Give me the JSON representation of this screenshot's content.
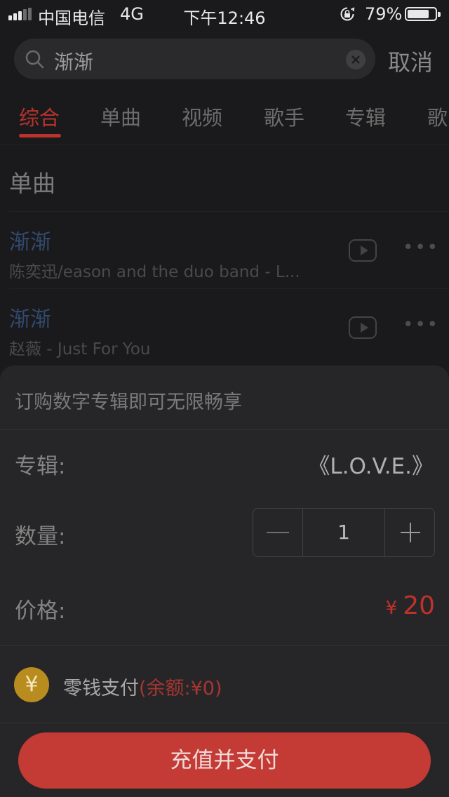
{
  "status_bar": {
    "carrier": "中国电信",
    "network": "4G",
    "time": "下午12:46",
    "battery_percent": "79%",
    "battery_level": 0.79,
    "signal_bars": 5,
    "signal_bars_filled": 3
  },
  "search": {
    "query": "渐渐",
    "icon": "search-icon",
    "clear_icon": "clear-icon"
  },
  "cancel_label": "取消",
  "tabs": [
    {
      "label": "综合",
      "active": true
    },
    {
      "label": "单曲",
      "active": false
    },
    {
      "label": "视频",
      "active": false
    },
    {
      "label": "歌手",
      "active": false
    },
    {
      "label": "专辑",
      "active": false
    },
    {
      "label": "歌",
      "active": false
    }
  ],
  "songs_section": {
    "title": "单曲",
    "items": [
      {
        "title": "渐渐",
        "subtitle": "陈奕迅/eason and the duo band - L..."
      },
      {
        "title": "渐渐",
        "subtitle": "赵薇 - Just For You"
      }
    ]
  },
  "purchase_sheet": {
    "title": "订购数字专辑即可无限畅享",
    "album_label": "专辑:",
    "album_value": "《L.O.V.E.》",
    "quantity_label": "数量:",
    "quantity_value": "1",
    "price_label": "价格:",
    "price_currency": "¥",
    "price_amount": "20",
    "payment_icon": "¥",
    "payment_label": "零钱支付",
    "payment_balance": "(余额:¥0)",
    "pay_button": "充值并支付"
  },
  "colors": {
    "accent": "#b8322e",
    "price": "#c0312c",
    "button": "#c43b35",
    "coin": "#b88c1e",
    "link_title": "#314a6d"
  }
}
